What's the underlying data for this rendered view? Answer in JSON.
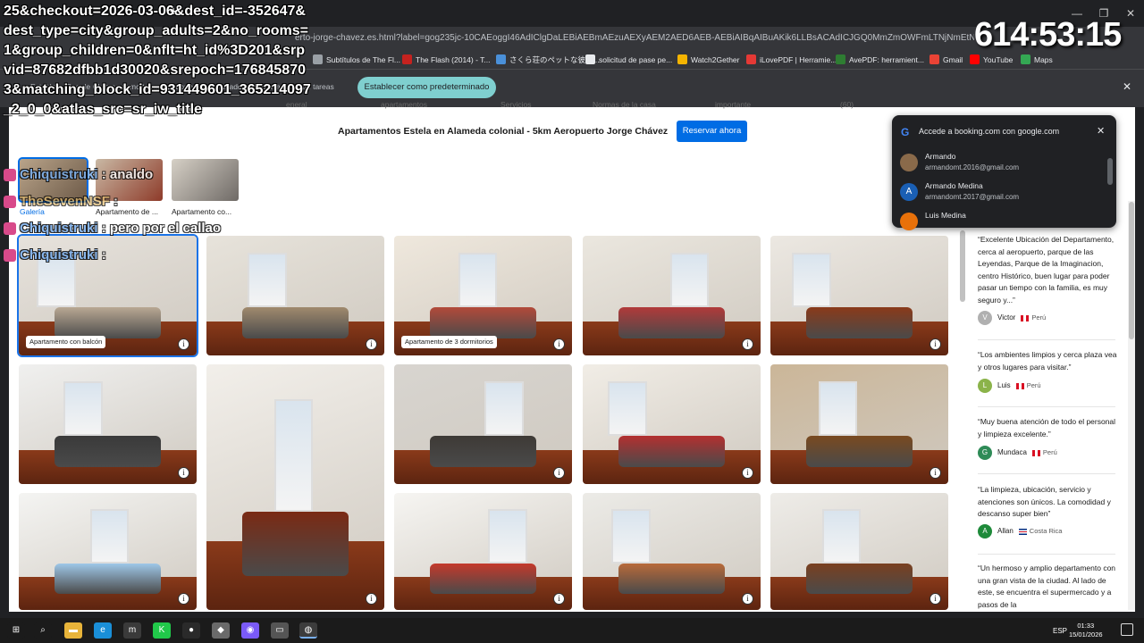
{
  "browser": {
    "url": "erto-jorge-chavez.es.html?label=gog235jc-10CAEoggI46AdIClgDaLEBiAEBmAEzuAEXyAEM2AED6AEB-AEBiAIBqAIBuAKik6LLBsACAdICJGQ0MmZmOWFmLTNjNmEtNGMwNC04ODgwLWU",
    "bookmarks": [
      {
        "label": "Subtítulos de The Fl...",
        "color": "#9aa0a6"
      },
      {
        "label": "The Flash (2014) - T...",
        "color": "#c5221f"
      },
      {
        "label": "さくら荘のペットな彼女...",
        "color": "#4a90d9"
      },
      {
        "label": "solicitud de pase pe...",
        "color": "#e8eaed"
      },
      {
        "label": "Watch2Gether",
        "color": "#f4b400"
      },
      {
        "label": "iLovePDF | Herramie...",
        "color": "#e53935"
      },
      {
        "label": "AvePDF: herramient...",
        "color": "#2e7d32"
      },
      {
        "label": "Gmail",
        "color": "#ea4335"
      },
      {
        "label": "YouTube",
        "color": "#ff0000"
      },
      {
        "label": "Maps",
        "color": "#34a853"
      }
    ],
    "infobar_text": "Establece Google Chrome como tu navegador predeterminado y fíjalo a la barra de tareas",
    "infobar_button": "Establecer como predeterminado",
    "close_icon": "✕"
  },
  "page": {
    "nav_tabs": [
      "eneral",
      "apartamentos",
      "Servicios",
      "Normas de la casa",
      "importante",
      "(60)"
    ],
    "hotel_title": "Apartamentos Estela en Alameda colonial - 5km Aeropuerto Jorge Chávez",
    "reserve_button": "Reservar ahora",
    "thumbnails": [
      {
        "label": "Galería",
        "colors": [
          "#b9a48a",
          "#6d5a48"
        ]
      },
      {
        "label": "Apartamento de ...",
        "colors": [
          "#c9b8a4",
          "#8e3b2a"
        ]
      },
      {
        "label": "Apartamento co...",
        "colors": [
          "#d6d0c6",
          "#6f6a66"
        ]
      }
    ],
    "photos": [
      {
        "tag": "Apartamento con balcón",
        "wall": "#e6e2dc",
        "accent": "#b9a893",
        "selected": true
      },
      {
        "tag": "",
        "wall": "#e7e3db",
        "accent": "#a08a6e",
        "selected": false
      },
      {
        "tag": "Apartamento de 3 dormitorios",
        "wall": "#efe8dd",
        "accent": "#b24a3a",
        "selected": false
      },
      {
        "tag": "",
        "wall": "#ebe7df",
        "accent": "#b13a3a",
        "selected": false
      },
      {
        "tag": "",
        "wall": "#ece8e2",
        "accent": "#8a3a1a",
        "selected": false
      },
      {
        "tag": "",
        "wall": "#f0f0ef",
        "accent": "#3a3a3a",
        "selected": false
      },
      {
        "tag": "",
        "wall": "#f2efea",
        "accent": "#7a2a14",
        "selected": false
      },
      {
        "tag": "",
        "wall": "#d8d5d0",
        "accent": "#3e3a36",
        "selected": false
      },
      {
        "tag": "",
        "wall": "#f1ede6",
        "accent": "#b33030",
        "selected": false
      },
      {
        "tag": "",
        "wall": "#cbb698",
        "accent": "#7a4a20",
        "selected": false
      },
      {
        "tag": "",
        "wall": "#f4f4f2",
        "accent": "#9ec7e8",
        "selected": false
      },
      {
        "tag": "",
        "wall": "#f6f5f2",
        "accent": "#c4392b",
        "selected": false
      },
      {
        "tag": "",
        "wall": "#ecebe7",
        "accent": "#b86a3a",
        "selected": false
      },
      {
        "tag": "",
        "wall": "#eeece8",
        "accent": "#7a4020",
        "selected": false
      }
    ],
    "info_icon": "i"
  },
  "reviews": [
    {
      "text": "“Excelente Ubicación del Departamento, cerca al aeropuerto, parque de las Leyendas, Parque de la Imaginacion, centro Histórico, buen lugar para poder pasar un tiempo con la familia, es muy seguro y...”",
      "name": "Victor",
      "initial": "V",
      "avatar_color": "#b0b0b0",
      "country": "Perú",
      "flag": "peru"
    },
    {
      "text": "“Los ambientes limpios y cerca plaza vea y otros lugares para visitar.”",
      "name": "Luis",
      "initial": "L",
      "avatar_color": "#8bb34a",
      "country": "Perú",
      "flag": "peru"
    },
    {
      "text": "“Muy buena atención de todo el personal y limpieza excelente.”",
      "name": "Mundaca",
      "initial": "G",
      "avatar_color": "#2e8b57",
      "country": "Perú",
      "flag": "peru"
    },
    {
      "text": "“La limpieza, ubicación, servicio y atenciones son únicos. La comodidad y descanso super bien”",
      "name": "Allan",
      "initial": "A",
      "avatar_color": "#1e8a3a",
      "country": "Costa Rica",
      "flag": "costarica"
    },
    {
      "text": "“Un hermoso y amplio departamento con una gran vista de la ciudad. Al lado de este, se encuentra el supermercado y a pasos de la",
      "name": "",
      "initial": "",
      "avatar_color": "",
      "country": "",
      "flag": ""
    }
  ],
  "google_popup": {
    "logo": "G",
    "title": "Accede a booking.com con google.com",
    "close": "✕",
    "accounts": [
      {
        "name": "Armando",
        "email": "armandomt.2016@gmail.com",
        "initial": "",
        "color": "#8a6a4a"
      },
      {
        "name": "Armando Medina",
        "email": "armandomt.2017@gmail.com",
        "initial": "A",
        "color": "#1a5fb4"
      },
      {
        "name": "Luis Medina",
        "email": "",
        "initial": "",
        "color": "#e8710a"
      }
    ]
  },
  "stream_overlay": {
    "timer": "614:53:15",
    "url_text": "25&checkout=2026-03-06&dest_id=-352647&dest_type=city&group_adults=2&no_rooms=1&group_children=0&nflt=ht_id%3D201&srpvid=87682dfbb1d30020&srepoch=1768458703&matching_block_id=931449601_365214097_2_0_0&atlas_src=sr_iw_title",
    "plus": "+",
    "chat": [
      {
        "name": "Chiquistruki",
        "message": ": analdo",
        "style": "chatname"
      },
      {
        "name": "TheSevenNSF",
        "message": ":",
        "style": "chatname2"
      },
      {
        "name": "Chiquistruki",
        "message": ": pero por el callao",
        "style": "chatname"
      },
      {
        "name": "Chiquistruki",
        "message": ":",
        "style": "chatname"
      }
    ]
  },
  "window_controls": {
    "minimize": "—",
    "maximize": "❐",
    "close": "✕"
  },
  "taskbar": {
    "apps": [
      {
        "name": "windows-start",
        "glyph": "⊞",
        "color": "#1b1b1b"
      },
      {
        "name": "search",
        "glyph": "⌕",
        "color": "#1b1b1b"
      },
      {
        "name": "file-explorer",
        "glyph": "▬",
        "color": "#e8b43a"
      },
      {
        "name": "edge",
        "glyph": "e",
        "color": "#1a8fd8"
      },
      {
        "name": "app-m",
        "glyph": "m",
        "color": "#3a3a3a"
      },
      {
        "name": "app-k",
        "glyph": "K",
        "color": "#21c94a"
      },
      {
        "name": "app-red",
        "glyph": "●",
        "color": "#2a2a2a"
      },
      {
        "name": "app-shield",
        "glyph": "◆",
        "color": "#6a6a6a"
      },
      {
        "name": "app-discord",
        "glyph": "◉",
        "color": "#7a5af8"
      },
      {
        "name": "app-drive",
        "glyph": "▭",
        "color": "#555"
      },
      {
        "name": "chrome",
        "glyph": "◍",
        "color": "#3c3c3c"
      }
    ],
    "language": "ESP",
    "time": "01:33",
    "date": "15/01/2026"
  }
}
